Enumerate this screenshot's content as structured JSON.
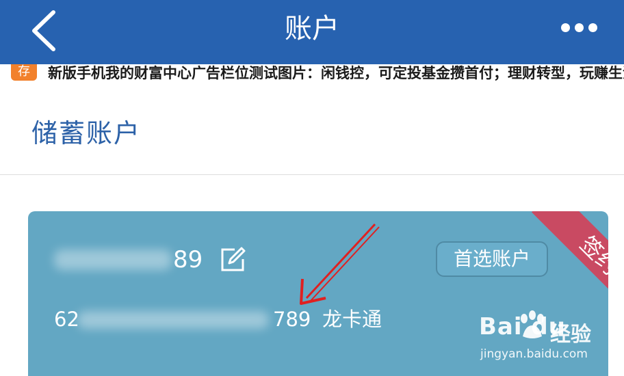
{
  "header": {
    "title": "账户",
    "back_icon": "chevron-left-icon",
    "more_icon": "more-dots-icon",
    "background": "#2762b0"
  },
  "notice": {
    "badge": "存",
    "text": "新版手机我的财富中心广告栏位测试图片：闲钱控，可定投基金攒首付；理财转型，玩赚生活"
  },
  "section": {
    "title": "储蓄账户"
  },
  "account_card": {
    "background": "#63a7c3",
    "short_number_tail": "89",
    "edit_icon": "edit-icon",
    "preferred_button": "首选账户",
    "ribbon": "签约",
    "ribbon_color": "#c94a62",
    "full_number_head": "62",
    "full_number_tail": "789",
    "card_type": "龙卡通"
  },
  "watermark": {
    "logo": "Bai du",
    "cn": "经验",
    "url": "jingyan.baidu.com"
  },
  "annotation": {
    "arrow_color": "#e02020"
  }
}
